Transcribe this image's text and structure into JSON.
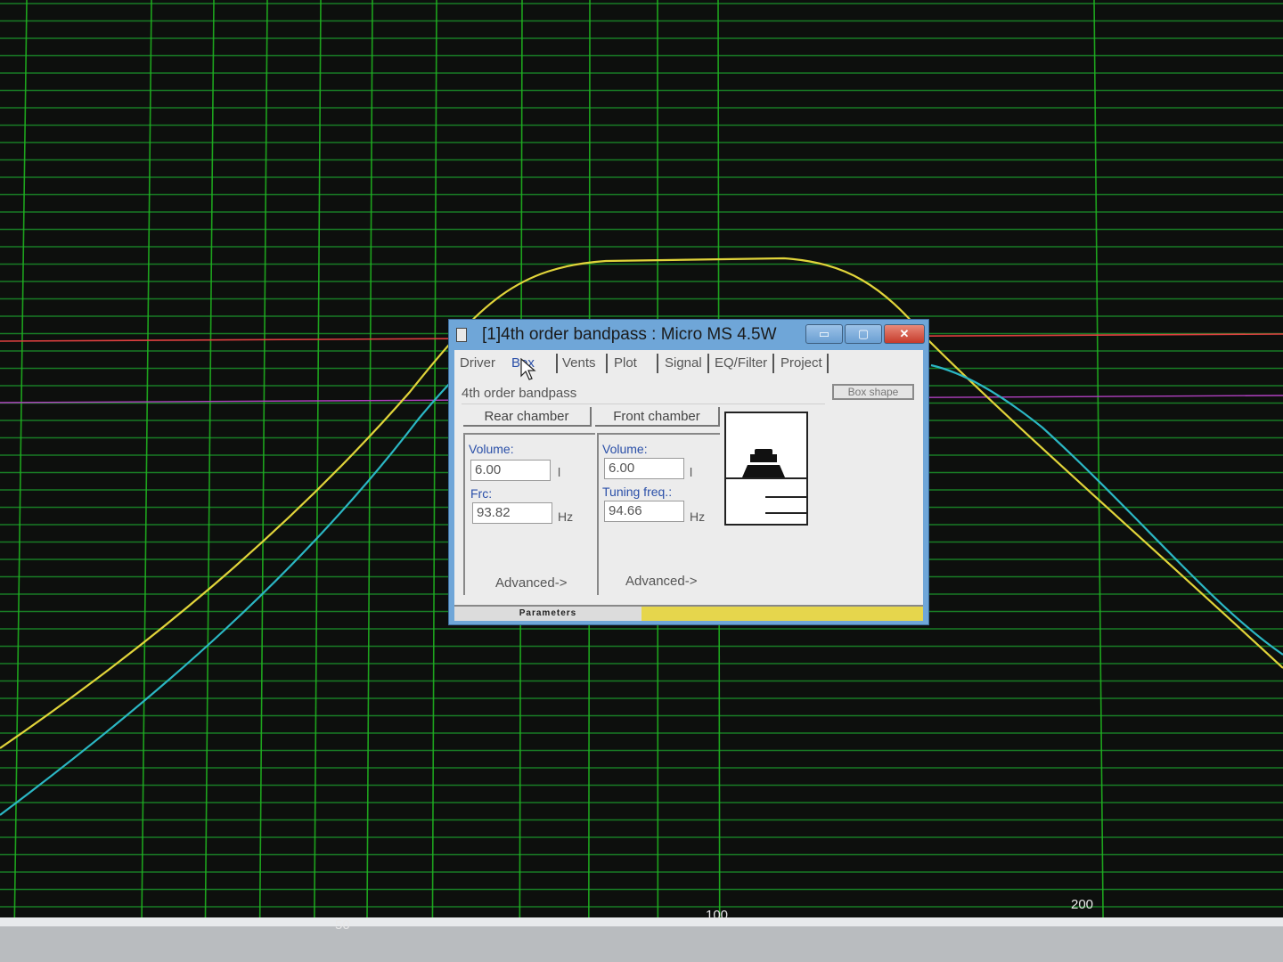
{
  "plot": {
    "background": "#0d0f0d",
    "grid_major_color": "#1fb31f",
    "grid_minor_color": "#1a8f2a",
    "ref_line_color": "#e04040",
    "ref_line2_color": "#b040c0",
    "series_colors": {
      "yellow": "#e1d43a",
      "cyan": "#2bb7c4"
    },
    "x_tick_labels": [
      "50",
      "100",
      "200"
    ]
  },
  "dialog": {
    "title": "[1]4th order bandpass : Micro MS 4.5W",
    "min_glyph": "▭",
    "max_glyph": "▢",
    "close_glyph": "✕",
    "tabs": [
      "Driver",
      "Box",
      "Vents",
      "Plot",
      "Signal",
      "EQ/Filter",
      "Project"
    ],
    "selected_tab": "Box",
    "description": "4th order bandpass",
    "box_shape_label": "Box shape",
    "rear": {
      "title": "Rear chamber",
      "volume_label": "Volume:",
      "volume_value": "6.00",
      "volume_unit": "l",
      "freq_label": "Frc:",
      "freq_value": "93.82",
      "freq_unit": "Hz",
      "advanced_label": "Advanced->"
    },
    "front": {
      "title": "Front chamber",
      "volume_label": "Volume:",
      "volume_value": "6.00",
      "volume_unit": "l",
      "freq_label": "Tuning freq.:",
      "freq_value": "94.66",
      "freq_unit": "Hz",
      "advanced_label": "Advanced->"
    },
    "status_label": "Parameters"
  }
}
